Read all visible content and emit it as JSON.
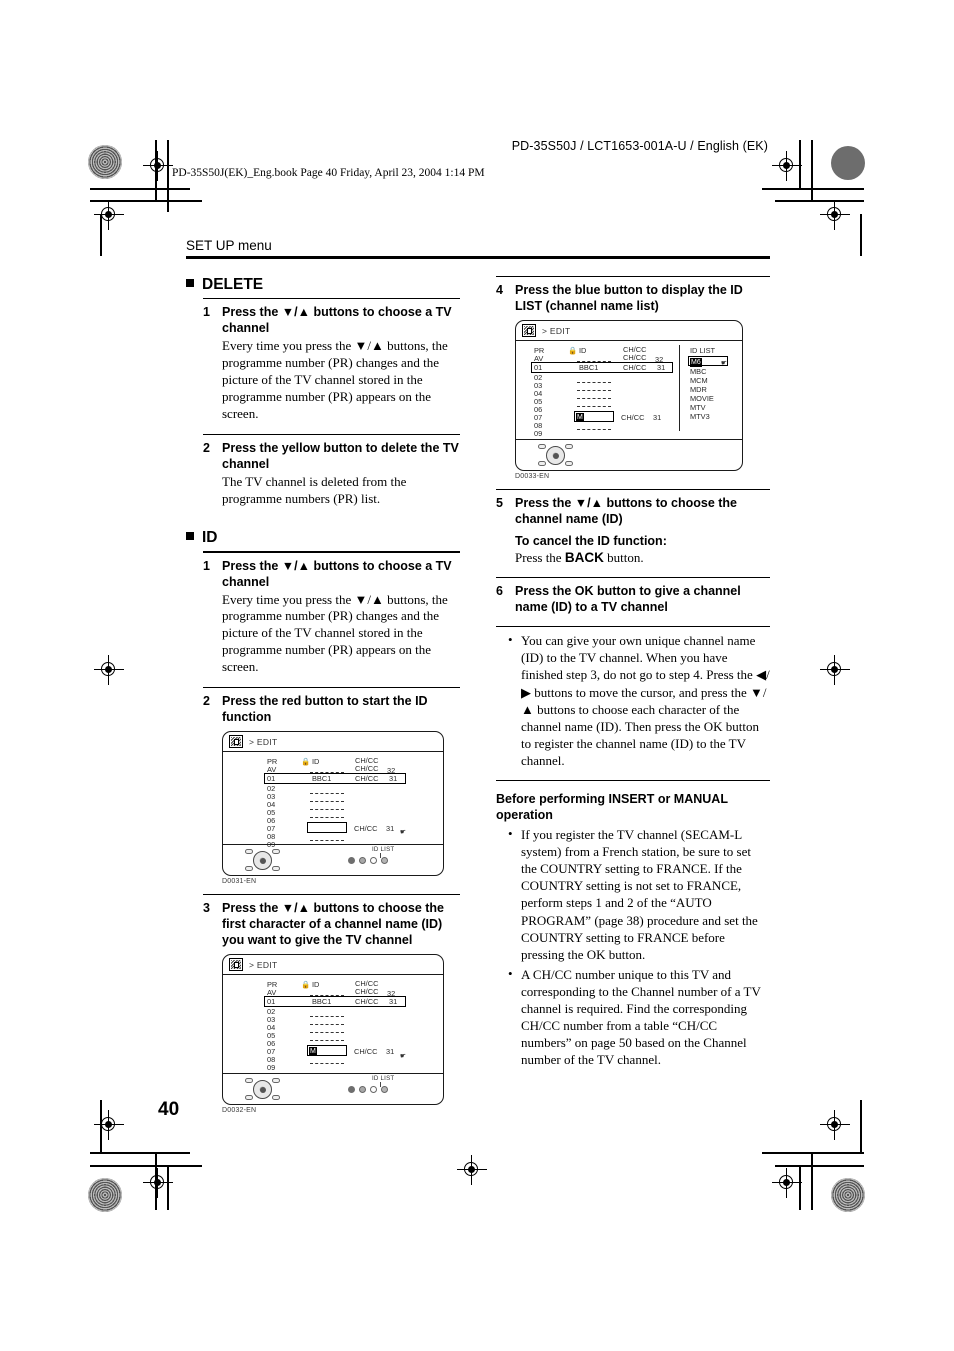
{
  "header": {
    "doc_code": "PD-35S50J / LCT1653-001A-U / English (EK)",
    "book_line": "PD-35S50J(EK)_Eng.book  Page 40  Friday, April 23, 2004  1:14 PM",
    "running_head": "SET UP menu"
  },
  "page_number": "40",
  "left_column": {
    "delete": {
      "heading": "DELETE",
      "steps": [
        {
          "num": "1",
          "title": "Press the ▼/▲ buttons to choose a TV channel",
          "body": "Every time you press the ▼/▲ buttons, the programme number (PR) changes and the picture of the TV channel stored in the programme number (PR) appears on the screen."
        },
        {
          "num": "2",
          "title": "Press the yellow button to delete the TV channel",
          "body": "The TV channel is deleted from the programme numbers (PR) list."
        }
      ]
    },
    "id": {
      "heading": "ID",
      "steps": [
        {
          "num": "1",
          "title": "Press the ▼/▲ buttons to choose a TV channel",
          "body": "Every time you press the ▼/▲ buttons, the programme number (PR) changes and the picture of the TV channel stored in the programme number (PR) appears on the screen."
        },
        {
          "num": "2",
          "title": "Press the red button to start the ID function",
          "body": ""
        },
        {
          "num": "3",
          "title": "Press the ▼/▲ buttons to choose the first character of a channel name (ID) you want to give the TV channel",
          "body": ""
        }
      ]
    }
  },
  "right_column": {
    "steps": [
      {
        "num": "4",
        "title": "Press the blue button to display the ID LIST (channel name list)"
      },
      {
        "num": "5",
        "title": "Press the ▼/▲ buttons to choose the channel name (ID)",
        "sub_head": "To cancel the ID function:",
        "sub_body_pre": "Press the ",
        "sub_body_key": "BACK",
        "sub_body_post": " button."
      },
      {
        "num": "6",
        "title": "Press the OK button to give a channel name (ID) to a TV channel"
      }
    ],
    "note_bullet": [
      "You can give your own unique channel name (ID) to the TV channel. When you have finished step 3, do not go to step 4. Press the ◀/▶ buttons to move the cursor, and press the ▼/▲ buttons to choose each character of the channel name (ID). Then press the OK button to register the channel name (ID) to the TV channel."
    ],
    "before_section": {
      "heading": "Before performing INSERT or MANUAL operation",
      "bullets": [
        "If you register the TV channel (SECAM-L system) from a French station, be sure to set the COUNTRY setting to FRANCE. If the COUNTRY setting is not set to FRANCE, perform steps 1 and 2 of the “AUTO PROGRAM” (page 38) procedure and set the COUNTRY setting to FRANCE before pressing the OK button.",
        "A CH/CC number unique to this TV and corresponding to the Channel number of a TV channel is required. Find the corresponding CH/CC number from a table “CH/CC numbers” on page 50 based on the Channel number of the TV channel."
      ]
    }
  },
  "figures": {
    "fig1": {
      "code": "D0031-EN",
      "titlebar": "> EDIT",
      "headers": {
        "pr": "PR",
        "id": "ID",
        "chcc": "CH/CC"
      },
      "av_row": {
        "label": "AV",
        "chcc": "CH/CC",
        "num": "32"
      },
      "selected_row": {
        "pr": "01",
        "id": "BBC1",
        "chcc": "CH/CC",
        "num": "31"
      },
      "rows": [
        "02",
        "03",
        "04",
        "05",
        "06",
        "07",
        "08",
        "09"
      ],
      "edit_row": {
        "pr": "07",
        "id": "",
        "chcc": "CH/CC",
        "num": "31"
      },
      "idlist_tag": "ID LIST"
    },
    "fig2": {
      "code": "D0032-EN",
      "titlebar": "> EDIT",
      "headers": {
        "pr": "PR",
        "id": "ID",
        "chcc": "CH/CC"
      },
      "av_row": {
        "label": "AV",
        "chcc": "CH/CC",
        "num": "32"
      },
      "selected_row": {
        "pr": "01",
        "id": "BBC1",
        "chcc": "CH/CC",
        "num": "31"
      },
      "rows": [
        "02",
        "03",
        "04",
        "05",
        "06",
        "07",
        "08",
        "09"
      ],
      "edit_row": {
        "pr": "07",
        "id": "M",
        "chcc": "CH/CC",
        "num": "31"
      },
      "idlist_tag": "ID LIST"
    },
    "fig3": {
      "code": "D0033-EN",
      "titlebar": "> EDIT",
      "headers": {
        "pr": "PR",
        "id": "ID",
        "chcc": "CH/CC"
      },
      "av_row": {
        "label": "AV",
        "chcc": "CH/CC",
        "num": "32"
      },
      "selected_row": {
        "pr": "01",
        "id": "BBC1",
        "chcc": "CH/CC",
        "num": "31"
      },
      "rows": [
        "02",
        "03",
        "04",
        "05",
        "06",
        "07",
        "08",
        "09"
      ],
      "edit_row": {
        "pr": "07",
        "id": "M",
        "chcc": "CH/CC",
        "num": "31"
      },
      "idlist": {
        "title": "ID LIST",
        "items": [
          "M6",
          "MBC",
          "MCM",
          "MDR",
          "MOVIE",
          "MTV",
          "MTV3"
        ],
        "selected": "M6"
      }
    }
  }
}
